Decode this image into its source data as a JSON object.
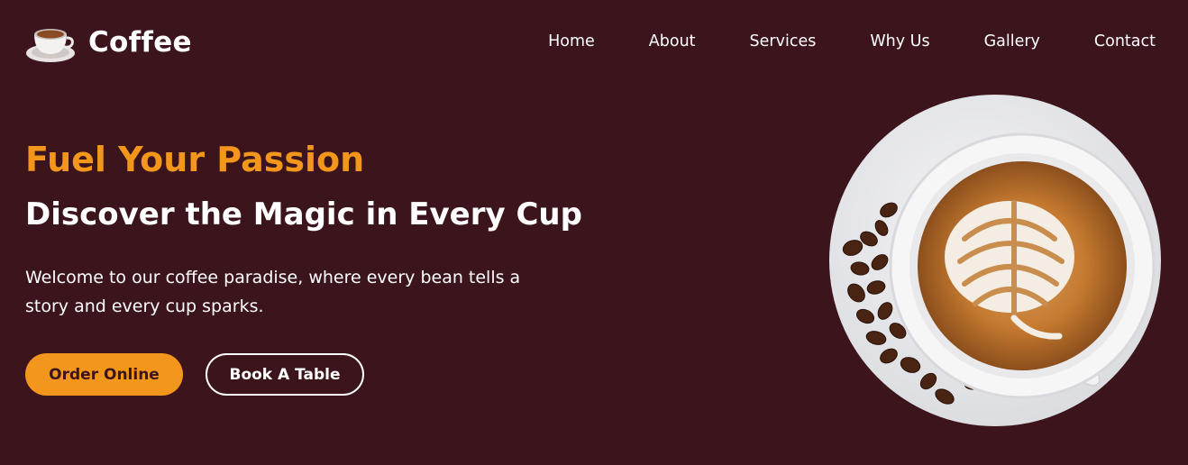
{
  "brand": {
    "name": "Coffee",
    "logo_icon": "coffee-cup-icon"
  },
  "nav": {
    "items": [
      "Home",
      "About",
      "Services",
      "Why Us",
      "Gallery",
      "Contact"
    ]
  },
  "hero": {
    "eyebrow": "Fuel Your Passion",
    "headline": "Discover the Magic in Every Cup",
    "description": "Welcome to our coffee paradise, where every bean tells a story and every cup sparks.",
    "primary_button": "Order Online",
    "secondary_button": "Book A Table",
    "image": "latte-art-coffee-cup-with-beans"
  },
  "colors": {
    "background": "#3b141c",
    "accent": "#f3961c",
    "text": "#ffffff"
  }
}
